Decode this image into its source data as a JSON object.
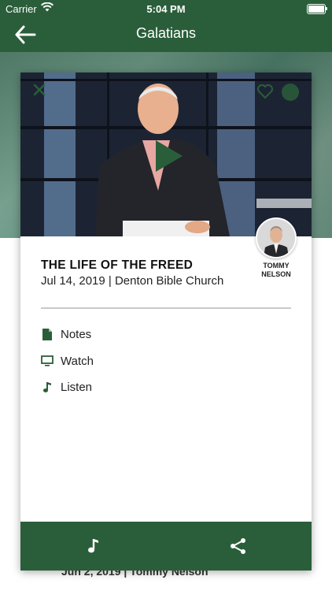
{
  "status": {
    "carrier": "Carrier",
    "time": "5:04 PM"
  },
  "nav": {
    "title": "Galatians"
  },
  "sermon": {
    "title": "THE LIFE OF THE FREED",
    "meta": "Jul 14, 2019 | Denton Bible Church",
    "speaker_line1": "TOMMY",
    "speaker_line2": "NELSON"
  },
  "actions": [
    {
      "label": "Notes",
      "icon": "document-icon"
    },
    {
      "label": "Watch",
      "icon": "monitor-icon"
    },
    {
      "label": "Listen",
      "icon": "music-note-icon"
    }
  ],
  "behind": {
    "text": "Jun 2, 2019 | Tommy Nelson"
  },
  "colors": {
    "brand": "#2a5e3a",
    "header_text": "#ffffff"
  }
}
